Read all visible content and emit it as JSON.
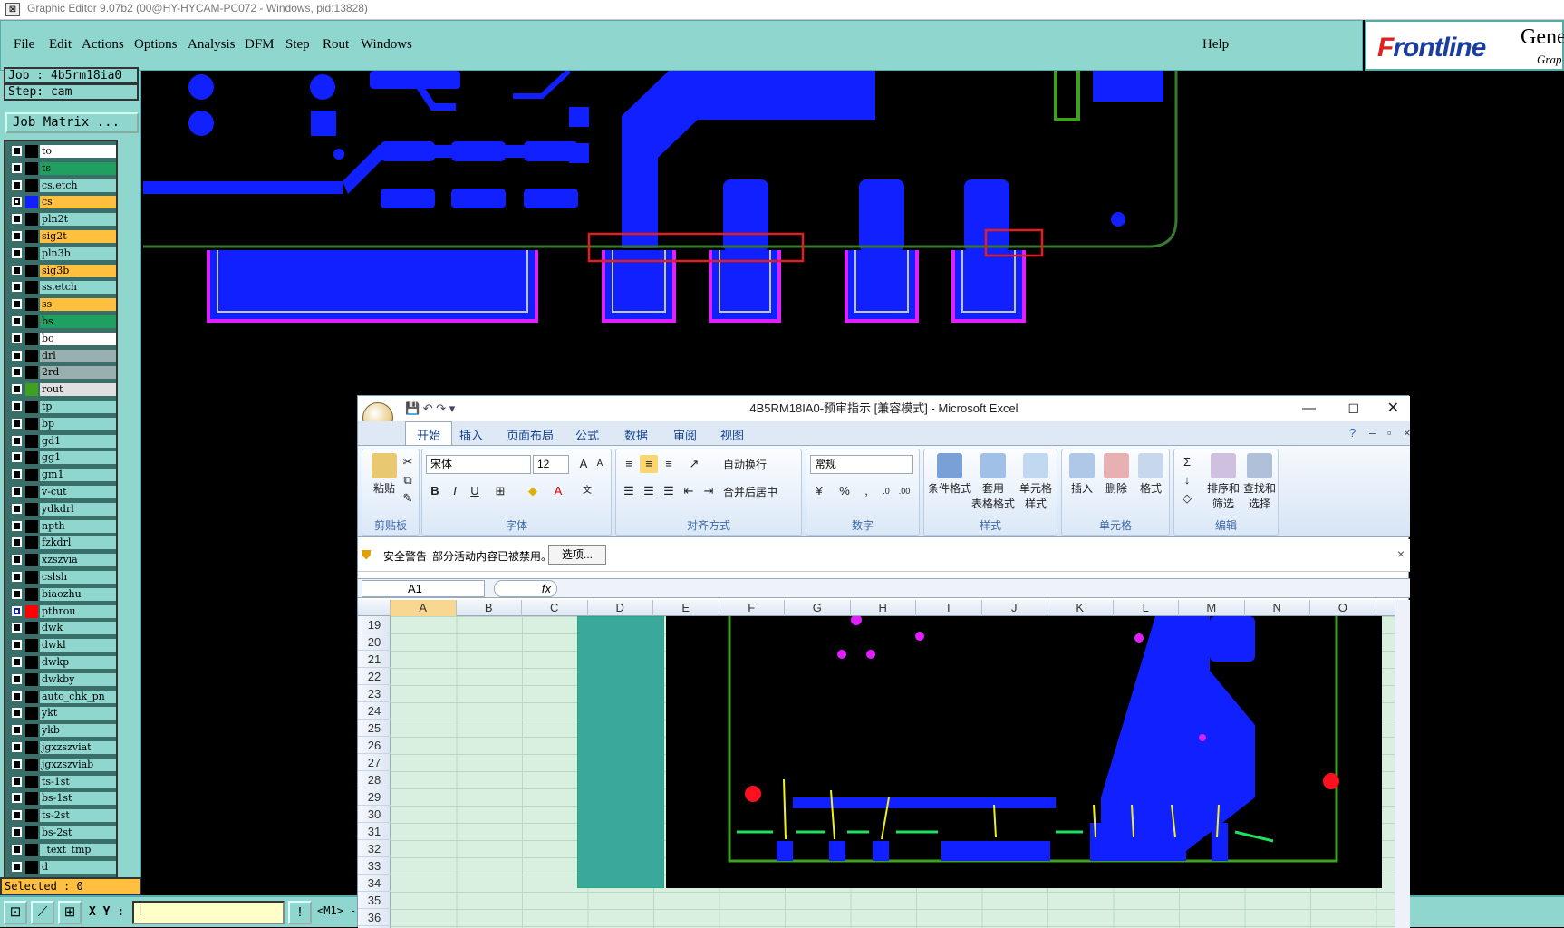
{
  "window": {
    "title": "Graphic Editor 9.07b2 (00@HY-HYCAM-PC072 - Windows, pid:13828)"
  },
  "menu": [
    "File",
    "Edit",
    "Actions",
    "Options",
    "Analysis",
    "DFM",
    "Step",
    "Rout",
    "Windows"
  ],
  "help": "Help",
  "brand": {
    "logo_a": "F",
    "logo_b": "rontline",
    "gen": "Gene",
    "gra": "Grap"
  },
  "job": {
    "job_label": "Job : 4b5rm18ia0",
    "step_label": "Step: cam",
    "matrix_button": "Job Matrix ..."
  },
  "layers": [
    {
      "name": "to",
      "color": "#ffffff"
    },
    {
      "name": "ts",
      "color": "#20a060"
    },
    {
      "name": "cs.etch",
      "color": "#8fd6cf"
    },
    {
      "name": "cs",
      "color": "#ffc040",
      "swatch": "#1020ff"
    },
    {
      "name": "pln2t",
      "color": "#8fd6cf"
    },
    {
      "name": "sig2t",
      "color": "#ffc040"
    },
    {
      "name": "pln3b",
      "color": "#8fd6cf"
    },
    {
      "name": "sig3b",
      "color": "#ffc040"
    },
    {
      "name": "ss.etch",
      "color": "#8fd6cf"
    },
    {
      "name": "ss",
      "color": "#ffc040"
    },
    {
      "name": "bs",
      "color": "#20a060"
    },
    {
      "name": "bo",
      "color": "#ffffff"
    },
    {
      "name": "drl",
      "color": "#9ab0b0"
    },
    {
      "name": "2rd",
      "color": "#9ab0b0"
    },
    {
      "name": "rout",
      "color": "#e0e0e0",
      "swatch": "#40a020"
    },
    {
      "name": "tp",
      "color": "#8fd6cf"
    },
    {
      "name": "bp",
      "color": "#8fd6cf"
    },
    {
      "name": "gd1",
      "color": "#8fd6cf"
    },
    {
      "name": "gg1",
      "color": "#8fd6cf"
    },
    {
      "name": "gm1",
      "color": "#8fd6cf"
    },
    {
      "name": "v-cut",
      "color": "#8fd6cf"
    },
    {
      "name": "ydkdrl",
      "color": "#8fd6cf"
    },
    {
      "name": "npth",
      "color": "#8fd6cf"
    },
    {
      "name": "fzkdrl",
      "color": "#8fd6cf"
    },
    {
      "name": "xzszvia",
      "color": "#8fd6cf"
    },
    {
      "name": "cslsh",
      "color": "#8fd6cf"
    },
    {
      "name": "biaozhu",
      "color": "#8fd6cf"
    },
    {
      "name": "pthrou",
      "color": "#8fd6cf",
      "swatch": "#ff0000",
      "active": true
    },
    {
      "name": "dwk",
      "color": "#8fd6cf"
    },
    {
      "name": "dwkl",
      "color": "#8fd6cf"
    },
    {
      "name": "dwkp",
      "color": "#8fd6cf"
    },
    {
      "name": "dwkby",
      "color": "#8fd6cf"
    },
    {
      "name": "auto_chk_pn",
      "color": "#8fd6cf"
    },
    {
      "name": "ykt",
      "color": "#8fd6cf"
    },
    {
      "name": "ykb",
      "color": "#8fd6cf"
    },
    {
      "name": "jgxzszviat",
      "color": "#8fd6cf"
    },
    {
      "name": "jgxzszviab",
      "color": "#8fd6cf"
    },
    {
      "name": "ts-1st",
      "color": "#8fd6cf"
    },
    {
      "name": "bs-1st",
      "color": "#8fd6cf"
    },
    {
      "name": "ts-2st",
      "color": "#8fd6cf"
    },
    {
      "name": "bs-2st",
      "color": "#8fd6cf"
    },
    {
      "name": "_text_tmp",
      "color": "#8fd6cf"
    },
    {
      "name": "d",
      "color": "#8fd6cf"
    }
  ],
  "status": {
    "selected": "Selected : 0",
    "xy_label": "X Y :",
    "mm_label": "<M1> -"
  },
  "excel": {
    "title": "4B5RM18IA0-预审指示 [兼容模式] - Microsoft Excel",
    "tabs": [
      "开始",
      "插入",
      "页面布局",
      "公式",
      "数据",
      "审阅",
      "视图"
    ],
    "groups": {
      "clipboard": "剪贴板",
      "font": "字体",
      "align": "对齐方式",
      "number": "数字",
      "style": "样式",
      "cells": "单元格",
      "edit": "编辑"
    },
    "paste": "粘贴",
    "font_name": "宋体",
    "font_size": "12",
    "wrap": "自动换行",
    "merge": "合并后居中",
    "numfmt": "常规",
    "cond_fmt": "条件格式",
    "table_fmt_a": "套用",
    "table_fmt_b": "表格格式",
    "cell_style_a": "单元格",
    "cell_style_b": "样式",
    "insert": "插入",
    "delete": "删除",
    "format": "格式",
    "sort_a": "排序和",
    "sort_b": "筛选",
    "find_a": "查找和",
    "find_b": "选择",
    "security_title": "安全警告",
    "security_msg": "部分活动内容已被禁用。",
    "options_btn": "选项...",
    "namebox": "A1",
    "fx": "fx",
    "columns": [
      "A",
      "B",
      "C",
      "D",
      "E",
      "F",
      "G",
      "H",
      "I",
      "J",
      "K",
      "L",
      "M",
      "N",
      "O"
    ],
    "rows": [
      "19",
      "20",
      "21",
      "22",
      "23",
      "24",
      "25",
      "26",
      "27",
      "28",
      "29",
      "30",
      "31",
      "32",
      "33",
      "34",
      "35",
      "36"
    ]
  }
}
